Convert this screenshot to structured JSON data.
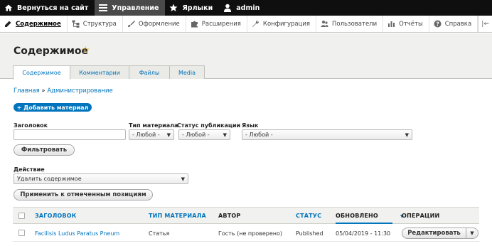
{
  "toolbar": {
    "back": "Вернуться на сайт",
    "manage": "Управление",
    "shortcuts": "Ярлыки",
    "user": "admin"
  },
  "tray": {
    "items": [
      "Содержимое",
      "Структура",
      "Оформление",
      "Расширения",
      "Конфигурация",
      "Пользователи",
      "Отчёты",
      "Справка"
    ],
    "toggle": "|⇐"
  },
  "page": {
    "title": "Содержимое",
    "tabs": [
      "Содержимое",
      "Комментарии",
      "Файлы",
      "Media"
    ]
  },
  "breadcrumb": {
    "home": "Главная",
    "sep": "»",
    "admin": "Администрирование"
  },
  "add_button": "+ Добавить материал",
  "filters": {
    "title_label": "Заголовок",
    "title_value": "",
    "type_label": "Тип материала",
    "type_value": "- Любой -",
    "status_label": "Статус публикации",
    "status_value": "- Любой -",
    "lang_label": "Язык",
    "lang_value": "- Любой -",
    "filter_button": "Фильтровать"
  },
  "bulk": {
    "label": "Действие",
    "value": "Удалить содержимое",
    "apply_button": "Применить к отмеченным позициям"
  },
  "table": {
    "headers": {
      "title": "ЗАГОЛОВОК",
      "type": "ТИП МАТЕРИАЛА",
      "author": "АВТОР",
      "status": "СТАТУС",
      "updated": "ОБНОВЛЕНО",
      "ops": "ОПЕРАЦИИ"
    },
    "rows": [
      {
        "title": "Facilisis Ludus Paratus Pneum",
        "type": "Статья",
        "author": "Гость (не проверено)",
        "status": "Published",
        "updated": "05/04/2019 - 11:30",
        "op": "Редактировать"
      }
    ]
  },
  "colors": {
    "accent": "#0074bd",
    "toolbar_bg": "#0f0f0f",
    "star": "#e0a500"
  }
}
